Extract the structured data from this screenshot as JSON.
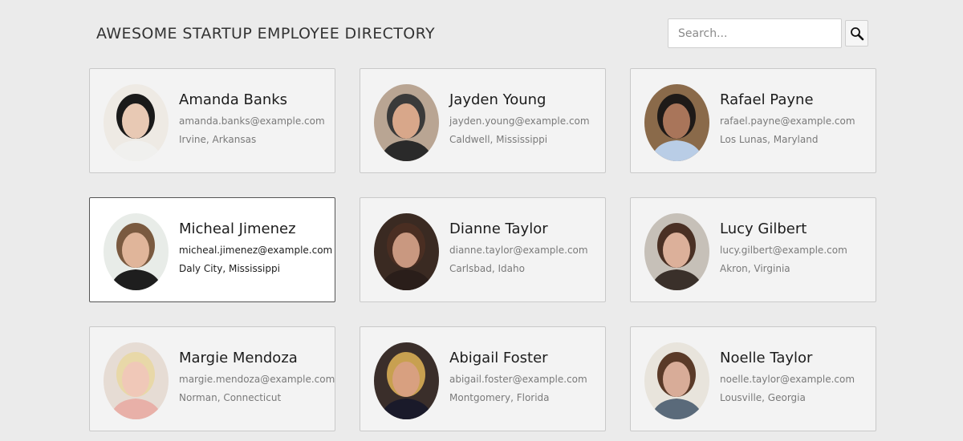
{
  "header": {
    "title": "AWESOME STARTUP EMPLOYEE DIRECTORY",
    "search_placeholder": "Search...",
    "search_icon": "magnifier-icon"
  },
  "employees": [
    {
      "name": "Amanda Banks",
      "email": "amanda.banks@example.com",
      "location": "Irvine, Arkansas",
      "avatar_colors": {
        "bg": "#eeeae4",
        "skin": "#e8c9b4",
        "hair": "#1a1a1a",
        "shirt": "#f0f0ee"
      }
    },
    {
      "name": "Jayden Young",
      "email": "jayden.young@example.com",
      "location": "Caldwell, Mississippi",
      "avatar_colors": {
        "bg": "#b9a593",
        "skin": "#d8a78a",
        "hair": "#3a3a3a",
        "shirt": "#2a2a2a"
      }
    },
    {
      "name": "Rafael Payne",
      "email": "rafael.payne@example.com",
      "location": "Los Lunas, Maryland",
      "avatar_colors": {
        "bg": "#8a6a4a",
        "skin": "#a9755a",
        "hair": "#1e1a18",
        "shirt": "#b9cde6"
      }
    },
    {
      "name": "Micheal Jimenez",
      "email": "micheal.jimenez@example.com",
      "location": "Daly City, Mississippi",
      "avatar_colors": {
        "bg": "#e8ece8",
        "skin": "#e0b59a",
        "hair": "#7a5a40",
        "shirt": "#1e1e1e"
      }
    },
    {
      "name": "Dianne Taylor",
      "email": "dianne.taylor@example.com",
      "location": "Carlsbad, Idaho",
      "avatar_colors": {
        "bg": "#3a2a22",
        "skin": "#c99880",
        "hair": "#4a2e22",
        "shirt": "#2a1e1a"
      }
    },
    {
      "name": "Lucy Gilbert",
      "email": "lucy.gilbert@example.com",
      "location": "Akron, Virginia",
      "avatar_colors": {
        "bg": "#c6c0b8",
        "skin": "#dcb09a",
        "hair": "#4a3024",
        "shirt": "#3a302a"
      }
    },
    {
      "name": "Margie Mendoza",
      "email": "margie.mendoza@example.com",
      "location": "Norman, Connecticut",
      "avatar_colors": {
        "bg": "#e6dcd4",
        "skin": "#f0c8b8",
        "hair": "#e8d8a8",
        "shirt": "#e8b0a8"
      }
    },
    {
      "name": "Abigail Foster",
      "email": "abigail.foster@example.com",
      "location": "Montgomery, Florida",
      "avatar_colors": {
        "bg": "#3a2e2a",
        "skin": "#d8a080",
        "hair": "#c8a050",
        "shirt": "#1a1a2a"
      }
    },
    {
      "name": "Noelle Taylor",
      "email": "noelle.taylor@example.com",
      "location": "Lousville, Georgia",
      "avatar_colors": {
        "bg": "#e8e4dc",
        "skin": "#d8ac98",
        "hair": "#5a3a28",
        "shirt": "#5a6a7a"
      }
    }
  ],
  "active_index": 3
}
